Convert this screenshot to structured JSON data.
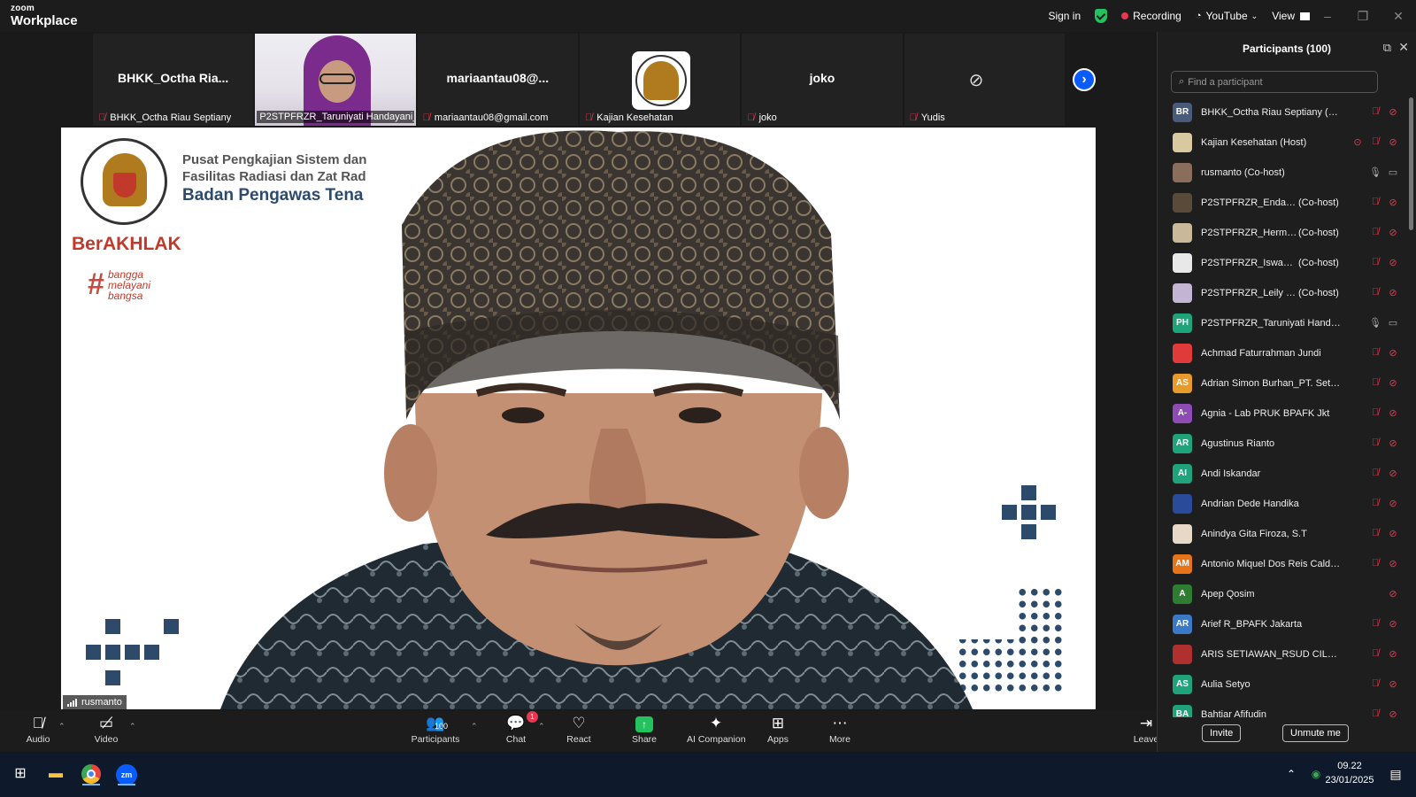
{
  "app": {
    "brand_line1": "zoom",
    "brand_line2": "Workplace"
  },
  "titlebar": {
    "sign_in": "Sign in",
    "recording": "Recording",
    "youtube": "YouTube",
    "view": "View"
  },
  "thumbs": [
    {
      "display": "BHKK_Octha  Ria...",
      "label": "BHKK_Octha Riau Septiany"
    },
    {
      "display": "",
      "label": "P2STPFRZR_Taruniyati Handayani_B..."
    },
    {
      "display": "mariaantau08@...",
      "label": "mariaantau08@gmail.com"
    },
    {
      "display": "",
      "label": "Kajian Kesehatan"
    },
    {
      "display": "joko",
      "label": "joko"
    },
    {
      "display": "",
      "label": "Yudis"
    }
  ],
  "slide": {
    "line1": "Pusat Pengkajian Sistem dan",
    "line2": "Fasilitas Radiasi dan Zat Rad",
    "line3": "Badan Pengawas Tena",
    "berakhlak": "BerAKHLAK",
    "bangga": [
      "bangga",
      "melayani",
      "bangsa"
    ]
  },
  "speaker": {
    "name": "rusmanto"
  },
  "toolbar": {
    "audio": "Audio",
    "video": "Video",
    "participants": "Participants",
    "participants_count": "100",
    "chat": "Chat",
    "chat_badge": "1",
    "react": "React",
    "share": "Share",
    "ai": "AI Companion",
    "apps": "Apps",
    "more": "More",
    "leave": "Leave"
  },
  "panel": {
    "title": "Participants (100)",
    "search_placeholder": "Find a participant",
    "invite": "Invite",
    "unmute": "Unmute me",
    "participants": [
      {
        "initials": "BR",
        "color": "#4a5a7a",
        "name": "BHKK_Octha Riau Septiany (Me)",
        "role": "",
        "mic": "off",
        "cam": "off",
        "rec": false
      },
      {
        "initials": "",
        "color": "#d8c9a0",
        "name": "Kajian Kesehatan (Host)",
        "role": "",
        "mic": "off",
        "cam": "off",
        "rec": true
      },
      {
        "initials": "",
        "color": "#8a6d5a",
        "name": "rusmanto (Co-host)",
        "role": "",
        "mic": "on",
        "cam": "on",
        "rec": false
      },
      {
        "initials": "",
        "color": "#5a4a3a",
        "name": "P2STPFRZR_Endang ...",
        "role": "(Co-host)",
        "mic": "off",
        "cam": "off",
        "rec": false
      },
      {
        "initials": "",
        "color": "#c9b99a",
        "name": "P2STPFRZR_Hermans...",
        "role": "(Co-host)",
        "mic": "off",
        "cam": "off",
        "rec": false
      },
      {
        "initials": "",
        "color": "#e8e8e8",
        "name": "P2STPFRZR_Iswandari...",
        "role": "(Co-host)",
        "mic": "off",
        "cam": "off",
        "rec": false
      },
      {
        "initials": "",
        "color": "#c4b4d4",
        "name": "P2STPFRZR_Leily Savitri",
        "role": "(Co-host)",
        "mic": "off",
        "cam": "off",
        "rec": false
      },
      {
        "initials": "PH",
        "color": "#1fa37a",
        "name": "P2STPFRZR_Taruniyati Handaya...",
        "role": "",
        "mic": "on",
        "cam": "on",
        "rec": false
      },
      {
        "initials": "",
        "color": "#e03a3a",
        "name": "Achmad Faturrahman Jundi",
        "role": "",
        "mic": "off",
        "cam": "off",
        "rec": false
      },
      {
        "initials": "AS",
        "color": "#e89a2a",
        "name": "Adrian Simon Burhan_PT. Setia ...",
        "role": "",
        "mic": "off",
        "cam": "off",
        "rec": false
      },
      {
        "initials": "A-",
        "color": "#8e4ab5",
        "name": "Agnia - Lab PRUK BPAFK Jkt",
        "role": "",
        "mic": "off",
        "cam": "off",
        "rec": false
      },
      {
        "initials": "AR",
        "color": "#1fa37a",
        "name": "Agustinus Rianto",
        "role": "",
        "mic": "off",
        "cam": "off",
        "rec": false
      },
      {
        "initials": "AI",
        "color": "#1fa37a",
        "name": "Andi Iskandar",
        "role": "",
        "mic": "off",
        "cam": "off",
        "rec": false
      },
      {
        "initials": "",
        "color": "#2a4a9a",
        "name": "Andrian Dede Handika",
        "role": "",
        "mic": "off",
        "cam": "off",
        "rec": false
      },
      {
        "initials": "",
        "color": "#e8d8c8",
        "name": "Anindya Gita Firoza, S.T",
        "role": "",
        "mic": "off",
        "cam": "off",
        "rec": false
      },
      {
        "initials": "AM",
        "color": "#e8741a",
        "name": "Antonio Miquel Dos Reis Calde...",
        "role": "",
        "mic": "off",
        "cam": "off",
        "rec": false
      },
      {
        "initials": "A",
        "color": "#2e7d32",
        "name": "Apep Qosim",
        "role": "",
        "mic": "none",
        "cam": "off",
        "rec": false
      },
      {
        "initials": "AR",
        "color": "#3a78c8",
        "name": "Arief R_BPAFK Jakarta",
        "role": "",
        "mic": "off",
        "cam": "off",
        "rec": false
      },
      {
        "initials": "",
        "color": "#b03030",
        "name": "ARIS SETIAWAN_RSUD CILEUN...",
        "role": "",
        "mic": "off",
        "cam": "off",
        "rec": false
      },
      {
        "initials": "AS",
        "color": "#1fa37a",
        "name": "Aulia Setyo",
        "role": "",
        "mic": "off",
        "cam": "off",
        "rec": false
      },
      {
        "initials": "BA",
        "color": "#1fa37a",
        "name": "Bahtiar Afifudin",
        "role": "",
        "mic": "off",
        "cam": "off",
        "rec": false
      }
    ]
  },
  "taskbar": {
    "time": "09.22",
    "date": "23/01/2025"
  },
  "colors": {
    "accent": "#0b5cff",
    "danger": "#e8384f",
    "panel_bg": "#1e1e1e"
  },
  "icons": [
    "zoom-logo-icon",
    "shield-check-icon",
    "record-dot-icon",
    "youtube-stream-icon",
    "grid-view-icon",
    "mic-off-icon",
    "camera-off-icon",
    "chevron-right-icon",
    "search-icon",
    "popout-icon",
    "close-icon",
    "participants-icon",
    "chat-icon",
    "heart-react-icon",
    "share-arrow-icon",
    "ai-sparkle-icon",
    "apps-icon",
    "more-icon",
    "leave-icon",
    "windows-start-icon",
    "folder-icon",
    "chrome-icon",
    "zoom-taskbar-icon",
    "wifi-icon",
    "notification-icon"
  ]
}
